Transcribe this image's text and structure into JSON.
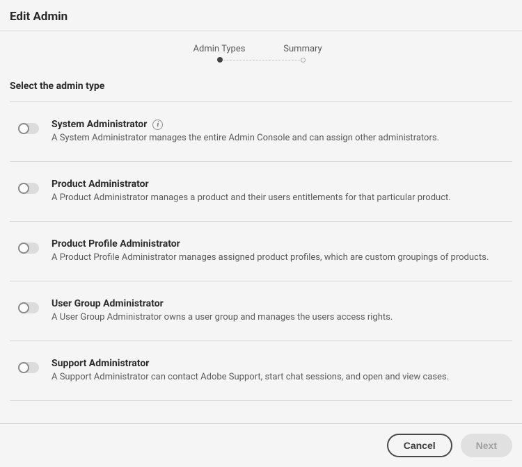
{
  "dialog": {
    "title": "Edit Admin"
  },
  "stepper": {
    "step1": "Admin Types",
    "step2": "Summary"
  },
  "section": {
    "label": "Select the admin type"
  },
  "options": [
    {
      "title": "System Administrator",
      "desc": "A System Administrator manages the entire Admin Console and can assign other administrators.",
      "hasInfo": true
    },
    {
      "title": "Product Administrator",
      "desc": "A Product Administrator manages a product and their users entitlements for that particular product.",
      "hasInfo": false
    },
    {
      "title": "Product Profile Administrator",
      "desc": "A Product Profile Administrator manages assigned product profiles, which are custom groupings of products.",
      "hasInfo": false
    },
    {
      "title": "User Group Administrator",
      "desc": "A User Group Administrator owns a user group and manages the users access rights.",
      "hasInfo": false
    },
    {
      "title": "Support Administrator",
      "desc": "A Support Administrator can contact Adobe Support, start chat sessions, and open and view cases.",
      "hasInfo": false
    }
  ],
  "footer": {
    "cancel": "Cancel",
    "next": "Next"
  }
}
